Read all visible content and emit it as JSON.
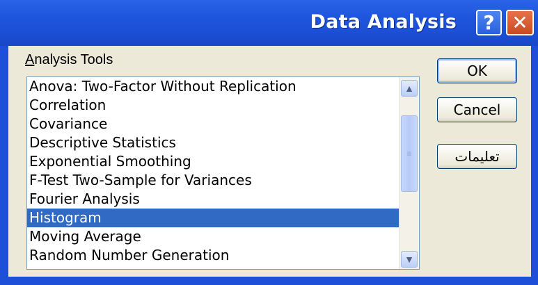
{
  "window": {
    "title": "Data Analysis",
    "help_label": "?",
    "close_label": "✕"
  },
  "group": {
    "label_first": "A",
    "label_rest": "nalysis Tools"
  },
  "list": {
    "items": [
      "Anova: Two-Factor Without Replication",
      "Correlation",
      "Covariance",
      "Descriptive Statistics",
      "Exponential Smoothing",
      "F-Test Two-Sample for Variances",
      "Fourier Analysis",
      "Histogram",
      "Moving Average",
      "Random Number Generation"
    ],
    "selected_index": 7
  },
  "buttons": {
    "ok": "OK",
    "cancel": "Cancel",
    "help": "تعليمات"
  },
  "icons": {
    "scroll_up": "▲",
    "scroll_down": "▼",
    "grip": "≡"
  }
}
